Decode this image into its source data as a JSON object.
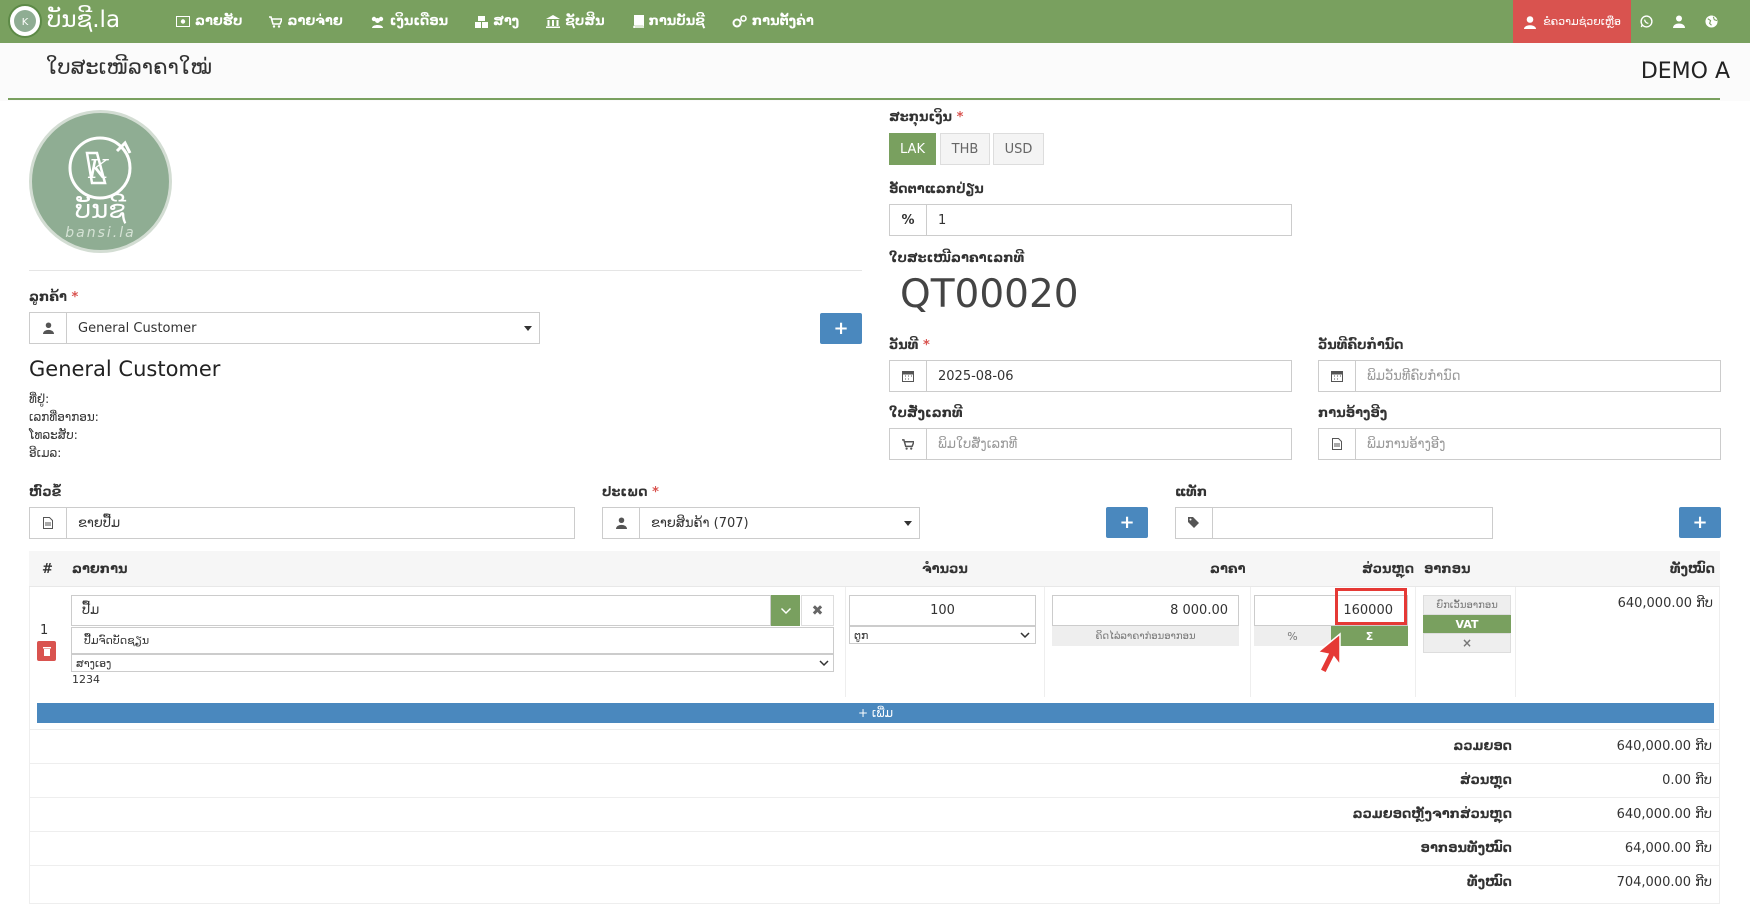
{
  "nav": {
    "brand": "ບັນຊີ.la",
    "logo_sub": "ບັນຊີ",
    "items": [
      {
        "label": "ລາຍຮັບ",
        "icon": "money-icon"
      },
      {
        "label": "ລາຍຈ່າຍ",
        "icon": "cart-icon"
      },
      {
        "label": "ເງິນເດືອນ",
        "icon": "users-icon"
      },
      {
        "label": "ສາງ",
        "icon": "cubes-icon"
      },
      {
        "label": "ຊັບສິນ",
        "icon": "bank-icon"
      },
      {
        "label": "ການບັນຊີ",
        "icon": "book-icon"
      },
      {
        "label": "ການຕັ້ງຄ່າ",
        "icon": "cogs-icon"
      }
    ],
    "help_label": "ຂໍຄວາມຊ່ວຍເຫຼືອ"
  },
  "page": {
    "title": "ໃບສະເໜີລາຄາໃໝ່",
    "company": "DEMO A"
  },
  "logo": {
    "text": "ບັນຊີ",
    "sub": "bansi.la"
  },
  "customer": {
    "label": "ລູກຄ້າ",
    "selected": "General Customer",
    "name": "General Customer",
    "address_label": "ທີ່ຢູ່:",
    "tax_label": "ເລກທີ່ອາກອນ:",
    "phone_label": "ໂທລະສັບ:",
    "email_label": "ອີເມລ:"
  },
  "currency": {
    "label": "ສະກຸນເງິນ",
    "options": [
      "LAK",
      "THB",
      "USD"
    ],
    "selected": "LAK"
  },
  "exchange": {
    "label": "ອັດຕາແລກປ່ຽນ",
    "value": "1",
    "addon": "%"
  },
  "quote_no": {
    "label": "ໃບສະເໜີລາຄາເລກທີ",
    "value": "QT00020"
  },
  "date": {
    "label": "ວັນທີ",
    "value": "2025-08-06"
  },
  "due_date": {
    "label": "ວັນທີຄົບກຳນົດ",
    "placeholder": "ພິມວັນທີຄົບກຳນົດ"
  },
  "po": {
    "label": "ໃບສັ່ງເລກທີ",
    "placeholder": "ພິມໃບສັ່ງເລກທີ"
  },
  "reference": {
    "label": "ການອ້າງອີງ",
    "placeholder": "ພິມການອ້າງອີງ"
  },
  "subject": {
    "label": "ຫົວຂໍ້",
    "value": "ຂາຍປື້ມ"
  },
  "type": {
    "label": "ປະເພດ",
    "value": "ຂາຍສິນຄ້າ (707)"
  },
  "tags": {
    "label": "ແທັກ"
  },
  "table": {
    "headers": {
      "num": "#",
      "item": "ລາຍການ",
      "qty": "ຈຳນວນ",
      "price": "ລາຄາ",
      "discount": "ສ່ວນຫຼຸດ",
      "tax": "ອາກອນ",
      "total": "ທັງໝົດ"
    },
    "row": {
      "num": "1",
      "item": "ປື້ມ",
      "description": "ປື້ມຈົດບັດຊຽນ",
      "warehouse": "ສາງເອງ",
      "code": "1234",
      "qty": "100",
      "unit": "ຕູກ",
      "price": "8 000.00",
      "price_note": "ຄິດໄລ່ລາຄາກ່ອນອາກອນ",
      "discount": "160000",
      "discount_pct": "%",
      "discount_sum": "Σ",
      "tax_exempt": "ຍົກເວັ້ນອາກອນ",
      "tax_vat": "VAT",
      "tax_clear": "×",
      "total": "640,000.00 ກີບ"
    },
    "add_label": "+ ເພີ່ມ"
  },
  "summary": [
    {
      "label": "ລວມຍອດ",
      "value": "640,000.00 ກີບ"
    },
    {
      "label": "ສ່ວນຫຼຸດ",
      "value": "0.00 ກີບ"
    },
    {
      "label": "ລວມຍອດຫຼັງຈາກສ່ວນຫຼຸດ",
      "value": "640,000.00 ກີບ"
    },
    {
      "label": "ອາກອນທັງໝົດ",
      "value": "64,000.00 ກີບ"
    },
    {
      "label": "ທັງໝົດ",
      "value": "704,000.00 ກີບ"
    }
  ],
  "colors": {
    "primary_green": "#79a05f",
    "blue": "#4a88be",
    "red": "#d9534f"
  }
}
